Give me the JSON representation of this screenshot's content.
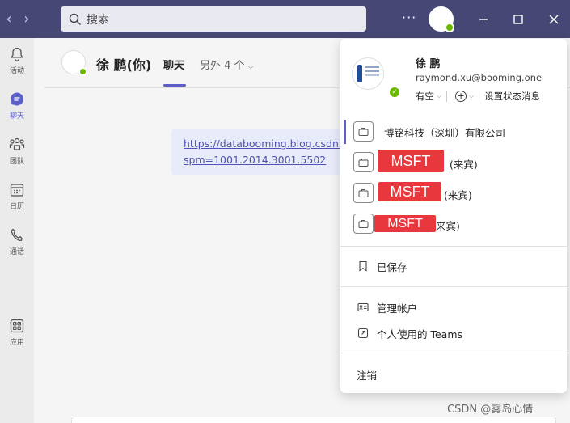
{
  "search": {
    "placeholder": "搜索"
  },
  "titlebar": {
    "more": "···"
  },
  "rail": {
    "items": [
      {
        "label": "活动",
        "icon": "bell-icon"
      },
      {
        "label": "聊天",
        "icon": "chat-icon"
      },
      {
        "label": "团队",
        "icon": "teams-icon"
      },
      {
        "label": "日历",
        "icon": "calendar-icon"
      },
      {
        "label": "通话",
        "icon": "phone-icon"
      },
      {
        "label": "应用",
        "icon": "apps-icon"
      }
    ],
    "more": "···"
  },
  "chat": {
    "name": "徐 鹏(你)",
    "tab": "聊天",
    "more": "另外 4 个",
    "message": {
      "line1": "https://databooming.blog.csdn.",
      "line2": "spm=1001.2014.3001.5502"
    }
  },
  "panel": {
    "name": "徐 鹏",
    "email": "raymond.xu@booming.one",
    "status": "有空",
    "set_status": "设置状态消息",
    "orgs": [
      {
        "name": "博铭科技（深圳）有限公司",
        "redacted": "",
        "suffix": ""
      },
      {
        "name": "",
        "redacted": "MSFT",
        "suffix": "(来宾)"
      },
      {
        "name": "",
        "redacted": "MSFT",
        "suffix": "(来宾)"
      },
      {
        "name": "",
        "redacted": "MSFT",
        "suffix": "来宾)"
      }
    ],
    "saved": "已保存",
    "manage_account": "管理帐户",
    "personal_teams": "个人使用的 Teams",
    "sign_out": "注销"
  },
  "watermark": "CSDN @雾岛心情",
  "colors": {
    "titlebar": "#464775",
    "accent": "#5b5fc7",
    "status_green": "#6bb700",
    "redaction": "#e8383d"
  }
}
